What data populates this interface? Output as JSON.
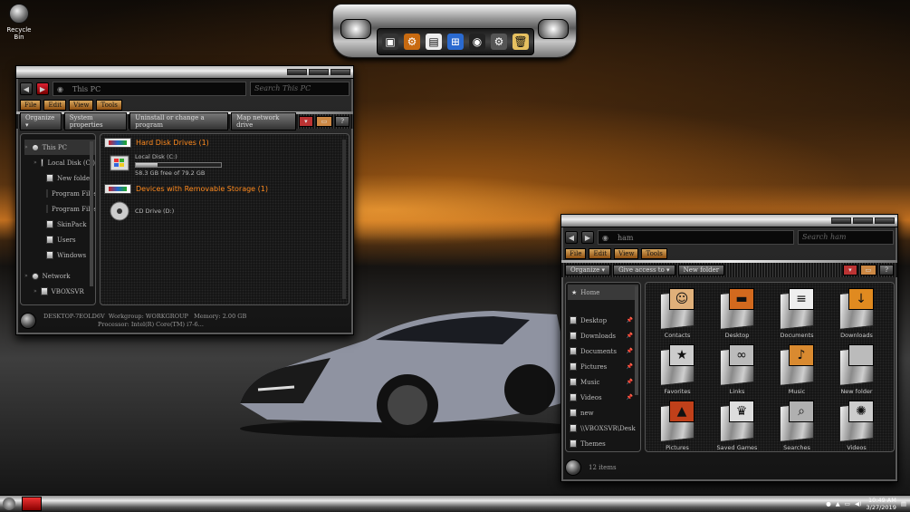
{
  "desktop": {
    "recycle_bin": "Recycle Bin"
  },
  "explorer1": {
    "address": "This PC",
    "search_placeholder": "Search This PC",
    "menu": [
      "File",
      "Edit",
      "View",
      "Tools"
    ],
    "toolbar": [
      "Organize",
      "System properties",
      "Uninstall or change a program",
      "Map network drive"
    ],
    "tree": [
      {
        "label": "This PC",
        "indent": 0
      },
      {
        "label": "Local Disk (C:)",
        "indent": 1
      },
      {
        "label": "New folder",
        "indent": 2
      },
      {
        "label": "Program Files",
        "indent": 2
      },
      {
        "label": "Program Files",
        "indent": 2
      },
      {
        "label": "SkinPack",
        "indent": 2
      },
      {
        "label": "Users",
        "indent": 2
      },
      {
        "label": "Windows",
        "indent": 2
      },
      {
        "label": "Network",
        "indent": 0
      },
      {
        "label": "VBOXSVR",
        "indent": 1
      }
    ],
    "sections": {
      "hard_disk": "Hard Disk Drives (1)",
      "removable": "Devices with Removable Storage (1)"
    },
    "drives": {
      "local_name": "Local Disk (C:)",
      "local_free": "58.3 GB free of 79.2 GB",
      "local_used_fraction": 0.26,
      "cd_name": "CD Drive (D:)"
    },
    "status": {
      "pc": "DESKTOP-7EOLD6V",
      "workgroup_label": "Workgroup:",
      "workgroup": "WORKGROUP",
      "memory_label": "Memory:",
      "memory": "2.00 GB",
      "processor_label": "Processor:",
      "processor": "Intel(R) Core(TM) i7-6..."
    }
  },
  "explorer2": {
    "address": "ham",
    "search_placeholder": "Search ham",
    "menu": [
      "File",
      "Edit",
      "View",
      "Tools"
    ],
    "toolbar": [
      "Organize",
      "Give access to",
      "New folder"
    ],
    "home": "Home",
    "quick_access": [
      {
        "label": "Desktop",
        "pinned": true
      },
      {
        "label": "Downloads",
        "pinned": true
      },
      {
        "label": "Documents",
        "pinned": true
      },
      {
        "label": "Pictures",
        "pinned": true
      },
      {
        "label": "Music",
        "pinned": true
      },
      {
        "label": "Videos",
        "pinned": true
      },
      {
        "label": "new",
        "pinned": false
      },
      {
        "label": "\\\\VBOXSVR\\Desk",
        "pinned": false
      },
      {
        "label": "Themes",
        "pinned": false
      }
    ],
    "items": [
      {
        "label": "Contacts",
        "icon": "contacts-icon",
        "glyph": "☺",
        "bg": "#e0b07a"
      },
      {
        "label": "Desktop",
        "icon": "desktop-icon",
        "glyph": "▬",
        "bg": "#d2691e"
      },
      {
        "label": "Documents",
        "icon": "documents-icon",
        "glyph": "≡",
        "bg": "#eeeeee"
      },
      {
        "label": "Downloads",
        "icon": "downloads-icon",
        "glyph": "↓",
        "bg": "#e08a20"
      },
      {
        "label": "Favorites",
        "icon": "favorites-icon",
        "glyph": "★",
        "bg": "#cccccc"
      },
      {
        "label": "Links",
        "icon": "links-icon",
        "glyph": "∞",
        "bg": "#bbbbbb"
      },
      {
        "label": "Music",
        "icon": "music-icon",
        "glyph": "♪",
        "bg": "#d98a30"
      },
      {
        "label": "New folder",
        "icon": "folder-icon",
        "glyph": "",
        "bg": "#bbbbbb"
      },
      {
        "label": "Pictures",
        "icon": "pictures-icon",
        "glyph": "▲",
        "bg": "#c0401a"
      },
      {
        "label": "Saved Games",
        "icon": "trophy-icon",
        "glyph": "♛",
        "bg": "#dddddd"
      },
      {
        "label": "Searches",
        "icon": "magnifier-icon",
        "glyph": "⌕",
        "bg": "#b0b0b0"
      },
      {
        "label": "Videos",
        "icon": "film-reel-icon",
        "glyph": "✺",
        "bg": "#cccccc"
      }
    ],
    "status": "12 items"
  },
  "taskbar": {
    "time": "10:49 AM",
    "date": "3/27/2019"
  },
  "colors": {
    "accent": "#ff8a1e",
    "menu": "#c8893a"
  }
}
